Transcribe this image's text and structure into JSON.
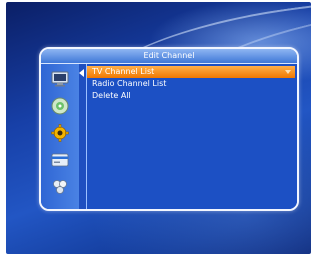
{
  "window": {
    "title": "Edit Channel"
  },
  "menu": {
    "items": [
      {
        "label": "TV Channel List",
        "selected": true
      },
      {
        "label": "Radio Channel List",
        "selected": false
      },
      {
        "label": "Delete All",
        "selected": false
      }
    ]
  },
  "sidebar": {
    "icons": [
      "tv-icon",
      "disc-icon",
      "gear-icon",
      "card-icon",
      "tools-icon"
    ]
  },
  "colors": {
    "highlight": "#f07800",
    "panel": "#1e4fc0",
    "border": "#f2f6ff"
  }
}
